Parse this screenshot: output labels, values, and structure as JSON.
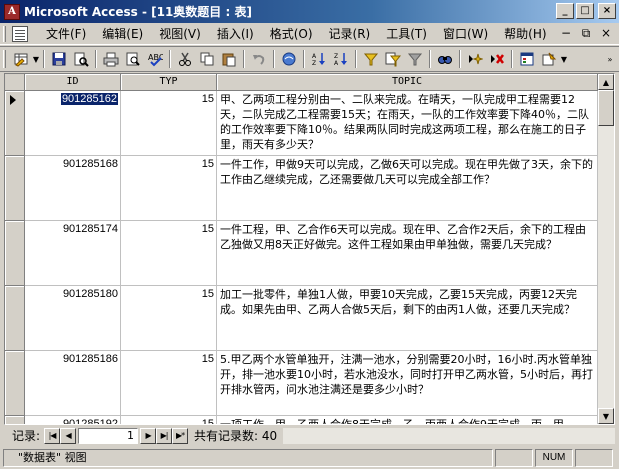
{
  "window": {
    "title": "Microsoft Access - [11奥数题目 : 表]"
  },
  "menu": {
    "items": [
      "文件(F)",
      "编辑(E)",
      "视图(V)",
      "插入(I)",
      "格式(O)",
      "记录(R)",
      "工具(T)",
      "窗口(W)",
      "帮助(H)"
    ]
  },
  "table": {
    "columns": [
      "ID",
      "TYP",
      "TOPIC"
    ],
    "rows": [
      {
        "id": "901285162",
        "typ": "15",
        "topic": "甲、乙两项工程分别由一、二队来完成。在晴天，一队完成甲工程需要12天，二队完成乙工程需要15天；在雨天，一队的工作效率要下降40％，二队的工作效率要下降10％。结果两队同时完成这两项工程，那么在施工的日子里，雨天有多少天？"
      },
      {
        "id": "901285168",
        "typ": "15",
        "topic": "一件工作，甲做9天可以完成，乙做6天可以完成。现在甲先做了3天，余下的工作由乙继续完成，乙还需要做几天可以完成全部工作？"
      },
      {
        "id": "901285174",
        "typ": "15",
        "topic": "一件工程，甲、乙合作6天可以完成。现在甲、乙合作2天后，余下的工程由乙独做又用8天正好做完。这件工程如果由甲单独做，需要几天完成？"
      },
      {
        "id": "901285180",
        "typ": "15",
        "topic": "加工一批零件，单独1人做，甲要10天完成，乙要15天完成，丙要12天完成。如果先由甲、乙两人合做5天后，剩下的由丙1人做，还要几天完成？"
      },
      {
        "id": "901285186",
        "typ": "15",
        "topic": "5.甲乙两个水管单独开，注满一池水，分别需要20小时，16小时.丙水管单独开，排一池水要10小时，若水池没水，同时打开甲乙两水管，5小时后，再打开排水管丙，问水池注满还是要多少小时？"
      },
      {
        "id": "901285192",
        "typ": "15",
        "topic": "一项工作，甲、乙两人合作8天完成，乙、丙两人合作9天完成，丙、甲"
      }
    ]
  },
  "navigator": {
    "label": "记录:",
    "current": "1",
    "total_text": "共有记录数: 40"
  },
  "status": {
    "view_text": "\"数据表\" 视图",
    "num": "NUM"
  }
}
